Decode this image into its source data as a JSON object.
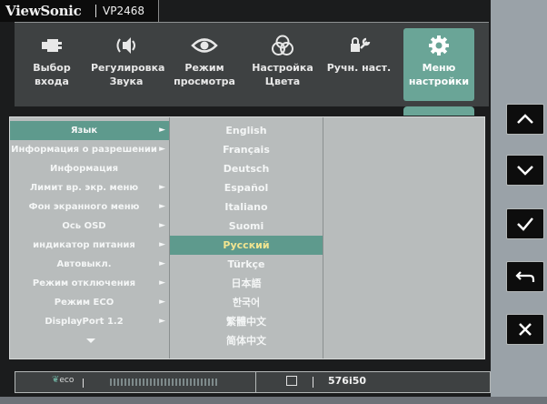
{
  "brand": {
    "name": "ViewSonic",
    "model": "VP2468"
  },
  "menu": [
    {
      "label1": "Выбор",
      "label2": "входа",
      "icon": "input-icon",
      "active": false
    },
    {
      "label1": "Регулировка",
      "label2": "Звука",
      "icon": "speaker-icon",
      "active": false
    },
    {
      "label1": "Режим",
      "label2": "просмотра",
      "icon": "eye-icon",
      "active": false
    },
    {
      "label1": "Настройка",
      "label2": "Цвета",
      "icon": "color-circles-icon",
      "active": false
    },
    {
      "label1": "Ручн. наст.",
      "label2": "",
      "icon": "wrench-icon",
      "active": false
    },
    {
      "label1": "Меню",
      "label2": "настройки",
      "icon": "gear-icon",
      "active": true
    }
  ],
  "settings": [
    {
      "label": "Язык",
      "arrow": "►",
      "selected": true
    },
    {
      "label": "Информация о разрешении",
      "arrow": "►",
      "selected": false
    },
    {
      "label": "Информация",
      "arrow": "",
      "selected": false
    },
    {
      "label": "Лимит вр. экр. меню",
      "arrow": "►",
      "selected": false
    },
    {
      "label": "Фон экранного меню",
      "arrow": "►",
      "selected": false
    },
    {
      "label": "Ось OSD",
      "arrow": "►",
      "selected": false
    },
    {
      "label": "индикатор питания",
      "arrow": "►",
      "selected": false
    },
    {
      "label": "Автовыкл.",
      "arrow": "►",
      "selected": false
    },
    {
      "label": "Режим отключения",
      "arrow": "►",
      "selected": false
    },
    {
      "label": "Режим ECO",
      "arrow": "►",
      "selected": false
    },
    {
      "label": "DisplayPort 1.2",
      "arrow": "►",
      "selected": false
    }
  ],
  "languages": [
    {
      "label": "English",
      "selected": false
    },
    {
      "label": "Français",
      "selected": false
    },
    {
      "label": "Deutsch",
      "selected": false
    },
    {
      "label": "Español",
      "selected": false
    },
    {
      "label": "Italiano",
      "selected": false
    },
    {
      "label": "Suomi",
      "selected": false
    },
    {
      "label": "Русский",
      "selected": true
    },
    {
      "label": "Türkçe",
      "selected": false
    },
    {
      "label": "日本語",
      "selected": false
    },
    {
      "label": "한국어",
      "selected": false
    },
    {
      "label": "繁體中文",
      "selected": false
    },
    {
      "label": "简体中文",
      "selected": false
    }
  ],
  "footer": {
    "eco_label": "eco",
    "resolution": "576i50"
  },
  "side_buttons": [
    {
      "name": "up-button",
      "icon": "chevron-up-icon"
    },
    {
      "name": "down-button",
      "icon": "chevron-down-icon"
    },
    {
      "name": "confirm-button",
      "icon": "check-icon"
    },
    {
      "name": "return-button",
      "icon": "return-icon"
    },
    {
      "name": "close-button",
      "icon": "close-icon"
    }
  ],
  "colors": {
    "accent": "#6aa597",
    "highlight_text": "#f2e590",
    "panel": "#b8bcbc",
    "menubar": "#3e4142"
  }
}
